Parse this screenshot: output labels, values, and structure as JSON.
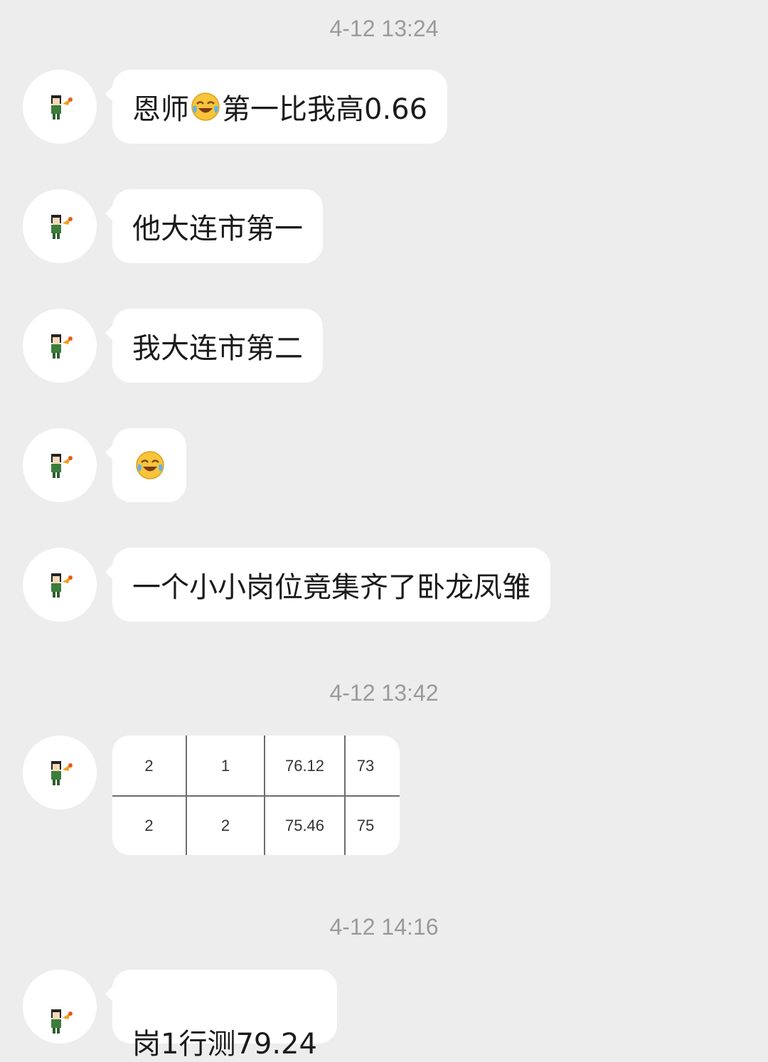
{
  "timestamps": [
    "4-12 13:24",
    "4-12 13:42",
    "4-12 14:16"
  ],
  "messages": [
    {
      "before": "恩师",
      "emoji": "laughing-crying-emoji",
      "after": "第一比我高0.66"
    },
    {
      "text": "他大连市第一"
    },
    {
      "text": "我大连市第二"
    },
    {
      "emoji": "laughing-crying-emoji"
    },
    {
      "text": "一个小小岗位竟集齐了卧龙凤雏"
    },
    {
      "text": "岗1行测79.24"
    }
  ],
  "table_image": {
    "rows": [
      [
        "2",
        "1",
        "76.12",
        "73"
      ],
      [
        "2",
        "2",
        "75.46",
        "75"
      ]
    ]
  },
  "colors": {
    "background": "#ededed",
    "bubble": "#ffffff",
    "timestamp": "#9a9a9a",
    "text": "#1b1b1b"
  }
}
